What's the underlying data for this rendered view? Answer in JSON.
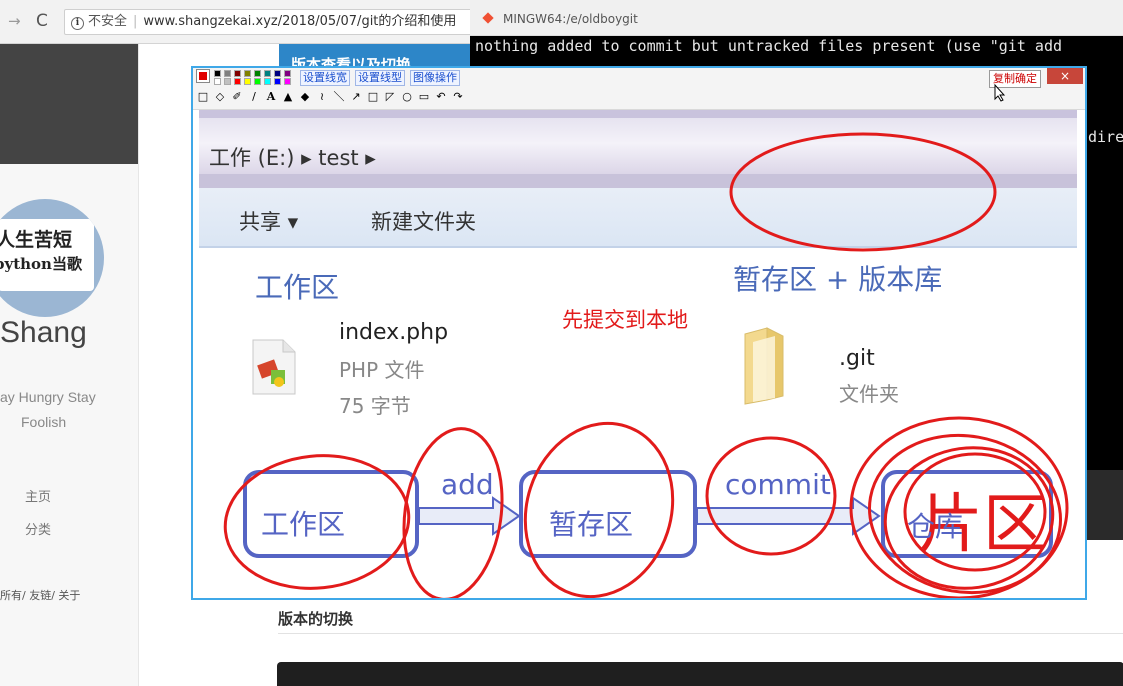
{
  "browser": {
    "nav_back": "→",
    "nav_reload": "C",
    "url_security": "不安全",
    "url": "www.shangzekai.xyz/2018/05/07/git的介绍和使用"
  },
  "blog": {
    "header_snippet": "版本查看以及切换",
    "avatar_line1": "人生苦短",
    "avatar_line2": "python当歌",
    "site_name": "Shang",
    "motto_line1": "ay Hungry Stay",
    "motto_line2": "Foolish",
    "nav": [
      "主页",
      "分类"
    ],
    "footer_links": "所有/ 友链/ 关于",
    "section_title": "版本的切换"
  },
  "terminal": {
    "title": "MINGW64:/e/oldboygit",
    "line1": "nothing added to commit but untracked files present (use \"git add",
    "line2": "dire",
    "icon_color": "#f05033"
  },
  "snip_tool": {
    "buttons": {
      "line_width": "设置线宽",
      "line_style": "设置线型",
      "image_op": "图像操作"
    },
    "confirm_copy": "复制确定",
    "close": "×",
    "tools": [
      "□",
      "◇",
      "✐",
      "/",
      "A",
      "▲",
      "◆",
      "≀",
      "＼",
      "↗",
      "□",
      "◸",
      "○",
      "▭",
      "↶",
      "↷"
    ],
    "palette_colors": [
      "#000000",
      "#808080",
      "#800000",
      "#808000",
      "#008000",
      "#008080",
      "#000080",
      "#800080",
      "#ffffff",
      "#c0c0c0",
      "#ff0000",
      "#ffff00",
      "#00ff00",
      "#00ffff",
      "#0000ff",
      "#ff00ff"
    ],
    "annotation_color": "#e21b1b"
  },
  "explorer": {
    "address": "工作 (E:)  ▸  test  ▸",
    "share": "共享 ▾",
    "new_folder": "新建文件夹",
    "area_working": "工作区",
    "area_stage_repo": "暂存区 + 版本库",
    "file": {
      "name": "index.php",
      "type": "PHP 文件",
      "size": "75 字节"
    },
    "folder": {
      "name": ".git",
      "type": "文件夹"
    }
  },
  "annotation": {
    "text": "先提交到本地",
    "handwritten": "片区"
  },
  "flow": {
    "working_dir": "工作区",
    "staging": "暂存区",
    "repository": "仓库",
    "add": "add",
    "commit": "commit",
    "color": "#5564c4"
  }
}
